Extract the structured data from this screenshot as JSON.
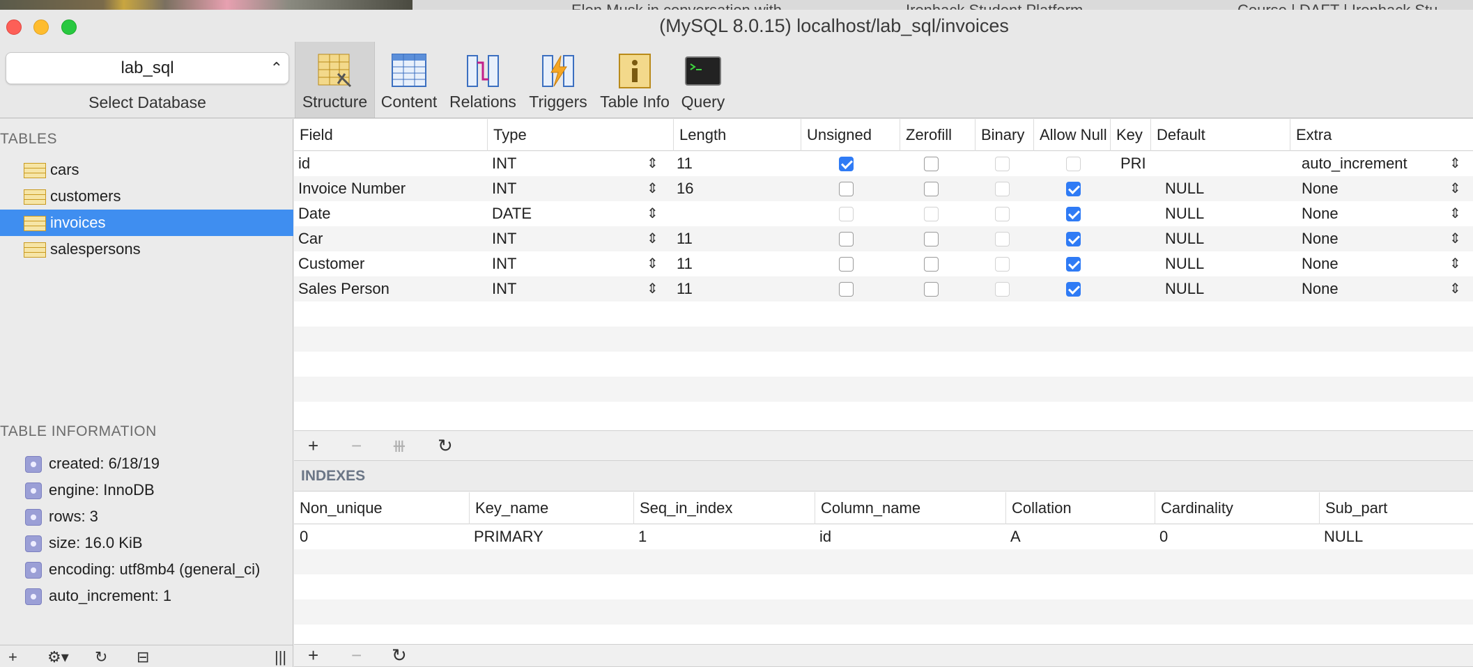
{
  "window": {
    "title": "(MySQL 8.0.15) localhost/lab_sql/invoices",
    "background_tabs": [
      "Elon Musk in conversation with",
      "Ironhack Student Platform",
      "Course | DAFT | Ironhack Stu"
    ]
  },
  "toolbar": {
    "database": "lab_sql",
    "database_caption": "Select Database",
    "buttons": [
      {
        "label": "Structure",
        "icon": "structure-icon"
      },
      {
        "label": "Content",
        "icon": "content-icon"
      },
      {
        "label": "Relations",
        "icon": "relations-icon"
      },
      {
        "label": "Triggers",
        "icon": "triggers-icon"
      },
      {
        "label": "Table Info",
        "icon": "table-info-icon"
      },
      {
        "label": "Query",
        "icon": "query-icon"
      }
    ],
    "active": "Structure"
  },
  "sidebar": {
    "tables_heading": "TABLES",
    "tables": [
      "cars",
      "customers",
      "invoices",
      "salespersons"
    ],
    "selected_table": "invoices",
    "info_heading": "TABLE INFORMATION",
    "info": [
      "created: 6/18/19",
      "engine: InnoDB",
      "rows: 3",
      "size: 16.0 KiB",
      "encoding: utf8mb4 (general_ci)",
      "auto_increment: 1"
    ]
  },
  "structure": {
    "columns": [
      "Field",
      "Type",
      "Length",
      "Unsigned",
      "Zerofill",
      "Binary",
      "Allow Null",
      "Key",
      "Default",
      "Extra"
    ],
    "rows": [
      {
        "field": "id",
        "type": "INT",
        "length": "11",
        "unsigned": true,
        "zerofill": false,
        "allow_null": false,
        "key": "PRI",
        "default": "",
        "extra": "auto_increment"
      },
      {
        "field": "Invoice Number",
        "type": "INT",
        "length": "16",
        "unsigned": false,
        "zerofill": false,
        "allow_null": true,
        "key": "",
        "default": "NULL",
        "extra": "None"
      },
      {
        "field": "Date",
        "type": "DATE",
        "length": "",
        "unsigned": false,
        "zerofill": false,
        "allow_null": true,
        "key": "",
        "default": "NULL",
        "extra": "None"
      },
      {
        "field": "Car",
        "type": "INT",
        "length": "11",
        "unsigned": false,
        "zerofill": false,
        "allow_null": true,
        "key": "",
        "default": "NULL",
        "extra": "None"
      },
      {
        "field": "Customer",
        "type": "INT",
        "length": "11",
        "unsigned": false,
        "zerofill": false,
        "allow_null": true,
        "key": "",
        "default": "NULL",
        "extra": "None"
      },
      {
        "field": "Sales Person",
        "type": "INT",
        "length": "11",
        "unsigned": false,
        "zerofill": false,
        "allow_null": true,
        "key": "",
        "default": "NULL",
        "extra": "None"
      }
    ],
    "tools": [
      "+",
      "−",
      "⧻",
      "↻"
    ]
  },
  "indexes": {
    "title": "INDEXES",
    "columns": [
      "Non_unique",
      "Key_name",
      "Seq_in_index",
      "Column_name",
      "Collation",
      "Cardinality",
      "Sub_part"
    ],
    "rows": [
      [
        "0",
        "PRIMARY",
        "1",
        "id",
        "A",
        "0",
        "NULL"
      ]
    ]
  },
  "colors": {
    "selection": "#3f8ef0",
    "checkbox_on": "#2f7bf5"
  }
}
